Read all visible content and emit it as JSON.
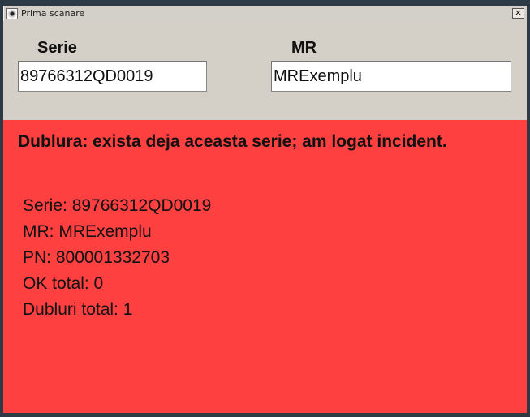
{
  "window": {
    "title": "Prima scanare",
    "close_symbol": "×"
  },
  "form": {
    "serie_label": "Serie",
    "serie_value": "89766312QD0019",
    "mr_label": "MR",
    "mr_value": "MRExemplu"
  },
  "status": {
    "background": "#ff4040",
    "headline": "Dublura: exista deja aceasta serie; am logat incident.",
    "lines": [
      "Serie: 89766312QD0019",
      "MR: MRExemplu",
      "PN: 800001332703",
      "OK total: 0",
      "Dubluri total: 1"
    ]
  }
}
